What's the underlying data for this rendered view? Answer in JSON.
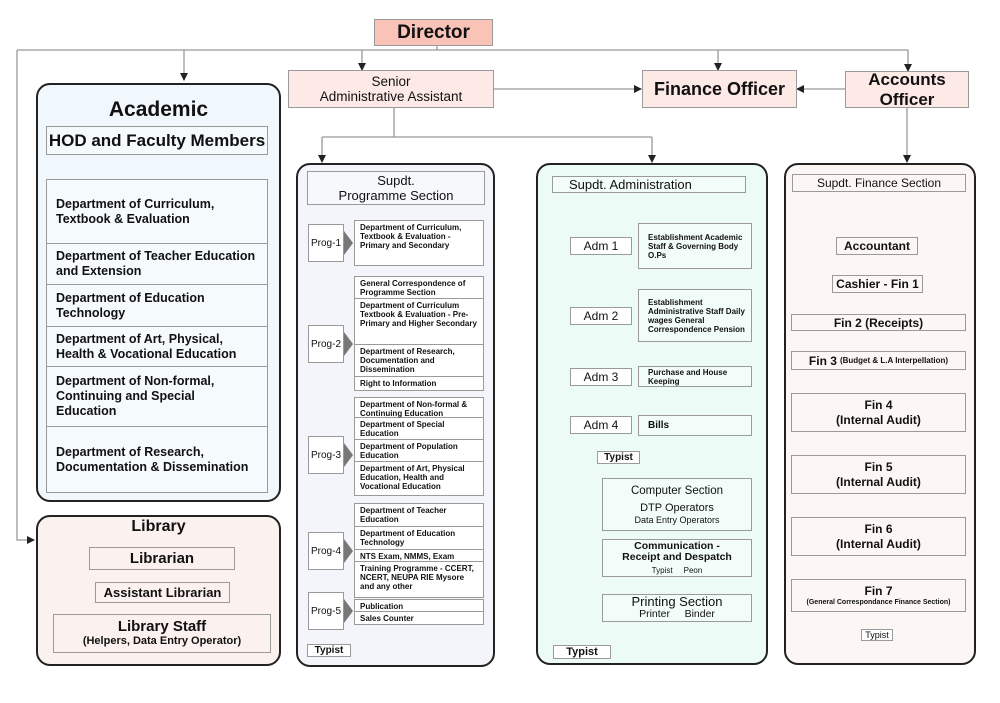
{
  "top": {
    "director": "Director",
    "senior_admin": [
      "Senior",
      "Administrative Assistant"
    ],
    "finance_officer": "Finance Officer",
    "accounts_officer": "Accounts Officer"
  },
  "academic": {
    "title": "Academic",
    "subtitle": "HOD and Faculty Members",
    "departments": [
      "Department of Curriculum, Textbook & Evaluation",
      "Department of Teacher Education and Extension",
      "Department of Education Technology",
      "Department of Art, Physical, Health & Vocational Education",
      "Department of Non-formal, Continuing and Special Education",
      "Department of Research, Documentation & Dissemination"
    ]
  },
  "library": {
    "title": "Library",
    "librarian": "Librarian",
    "assistant_librarian": "Assistant Librarian",
    "staff": "Library Staff",
    "staff_detail": "(Helpers, Data Entry Operator)"
  },
  "programme": {
    "header": [
      "Supdt.",
      "Programme Section"
    ],
    "groups": [
      {
        "label": "Prog-1",
        "items": [
          "Department of Curriculum, Textbook & Evaluation - Primary and Secondary"
        ]
      },
      {
        "label": "Prog-2",
        "items": [
          "General Correspondence of Programme Section",
          "Department of Curriculum Textbook & Evaluation - Pre-Primary and Higher Secondary",
          "Department of Research, Documentation and Dissemination",
          "Right to Information"
        ]
      },
      {
        "label": "Prog-3",
        "items": [
          "Department of Non-formal & Continuing Education",
          "Department of Special Education",
          "Department of Population Education",
          "Department of Art, Physical Education, Health and Vocational Education"
        ]
      },
      {
        "label": "Prog-4",
        "items": [
          "Department of Teacher Education",
          "Department of Education Technology",
          "NTS Exam, NMMS, Exam",
          "Training Programme - CCERT, NCERT, NEUPA RIE Mysore and any other"
        ]
      },
      {
        "label": "Prog-5",
        "items": [
          "Publication",
          "Sales Counter"
        ]
      }
    ],
    "typist": "Typist"
  },
  "administration": {
    "header": "Supdt. Administration",
    "units": [
      {
        "label": "Adm 1",
        "duties": "Establishment Academic Staff & Governing Body O.Ps"
      },
      {
        "label": "Adm 2",
        "duties": "Establishment Administrative Staff Daily wages General Correspondence Pension"
      },
      {
        "label": "Adm 3",
        "duties": "Purchase and House Keeping"
      },
      {
        "label": "Adm 4",
        "duties": "Bills"
      }
    ],
    "adm_typist": "Typist",
    "computer": {
      "title": "Computer Section",
      "line1": "DTP Operators",
      "line2": "Data Entry Operators"
    },
    "communication": {
      "title": "Communication - Receipt and Despatch",
      "staff": "Typist     Peon"
    },
    "printing": {
      "title": "Printing Section",
      "staff": "Printer     Binder"
    },
    "typist": "Typist"
  },
  "finance": {
    "header": "Supdt. Finance Section",
    "accountant": "Accountant",
    "cashier": "Cashier - Fin 1",
    "fin2": "Fin 2 (Receipts)",
    "fin3_label": "Fin 3",
    "fin3_detail": "(Budget & L.A Interpellation)",
    "units": [
      {
        "label": "Fin 4",
        "detail": "(Internal Audit)"
      },
      {
        "label": "Fin 5",
        "detail": "(Internal Audit)"
      },
      {
        "label": "Fin 6",
        "detail": "(Internal Audit)"
      }
    ],
    "fin7_label": "Fin 7",
    "fin7_detail": "(General Correspondance Finance Section)",
    "typist": "Typist"
  },
  "colors": {
    "director_fill": "#f9c3b8",
    "top_fill": "#fde9e6",
    "academic_fill": "#f1f8fd",
    "library_fill": "#fbf1ef",
    "programme_fill": "#f3f5fb",
    "admin_fill": "#ecfbf6",
    "finance_fill": "#fcf7f4"
  }
}
